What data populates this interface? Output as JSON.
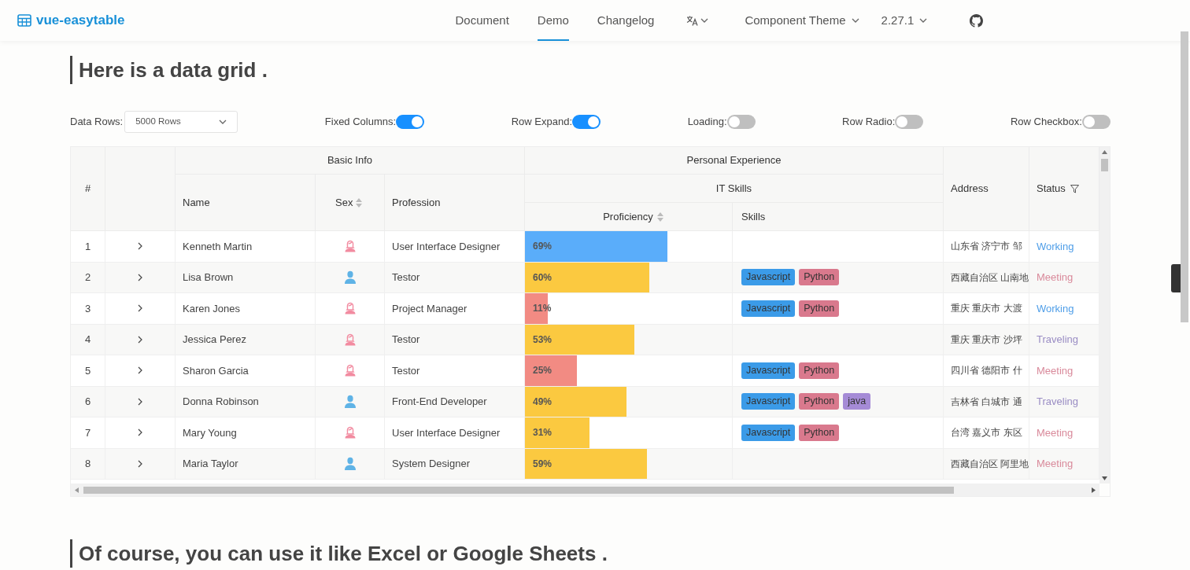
{
  "nav": {
    "logo": "vue-easytable",
    "links": [
      {
        "label": "Document",
        "selected": false
      },
      {
        "label": "Demo",
        "selected": true
      },
      {
        "label": "Changelog",
        "selected": false
      }
    ],
    "theme_menu": "Component Theme",
    "version_menu": "2.27.1"
  },
  "heading": "Here is a data grid .",
  "controls": {
    "data_rows_label": "Data Rows:",
    "data_rows_value": "5000 Rows",
    "toggles": [
      {
        "label": "Fixed Columns:",
        "on": true
      },
      {
        "label": "Row Expand:",
        "on": true
      },
      {
        "label": "Loading:",
        "on": false
      },
      {
        "label": "Row Radio:",
        "on": false
      },
      {
        "label": "Row Checkbox:",
        "on": false
      }
    ]
  },
  "table": {
    "header": {
      "index": "#",
      "basic_info": "Basic Info",
      "name": "Name",
      "sex": "Sex",
      "profession": "Profession",
      "personal_experience": "Personal Experience",
      "it_skills": "IT Skills",
      "proficiency": "Proficiency",
      "skills": "Skills",
      "address": "Address",
      "status": "Status"
    },
    "rows": [
      {
        "index": "1",
        "name": "Kenneth Martin",
        "kind": "female",
        "profession": "User Interface Designer",
        "proficiency": {
          "reading": "69%",
          "level": 0.69,
          "color": "#5aadfa"
        },
        "skills": [],
        "address": "山东省 济宁市 邹",
        "status": {
          "label": "Working",
          "color": "#4f9ee8"
        }
      },
      {
        "index": "2",
        "name": "Lisa Brown",
        "kind": "male",
        "profession": "Testor",
        "proficiency": {
          "reading": "60%",
          "level": 0.6,
          "color": "#fbc940"
        },
        "skills": [
          {
            "label": "Javascript",
            "color": "#3b9be8"
          },
          {
            "label": "Python",
            "color": "#d9798d"
          }
        ],
        "address": "西藏自治区 山南地",
        "status": {
          "label": "Meeting",
          "color": "#d98a9b"
        }
      },
      {
        "index": "3",
        "name": "Karen Jones",
        "kind": "female",
        "profession": "Project Manager",
        "proficiency": {
          "reading": "11%",
          "level": 0.11,
          "color": "#f28b83"
        },
        "skills": [
          {
            "label": "Javascript",
            "color": "#3b9be8"
          },
          {
            "label": "Python",
            "color": "#d9798d"
          }
        ],
        "address": "重庆 重庆市 大渡",
        "status": {
          "label": "Working",
          "color": "#4f9ee8"
        }
      },
      {
        "index": "4",
        "name": "Jessica Perez",
        "kind": "female",
        "profession": "Testor",
        "proficiency": {
          "reading": "53%",
          "level": 0.53,
          "color": "#fbc940"
        },
        "skills": [],
        "address": "重庆 重庆市 沙坪",
        "status": {
          "label": "Traveling",
          "color": "#9a8dc4"
        }
      },
      {
        "index": "5",
        "name": "Sharon Garcia",
        "kind": "female",
        "profession": "Testor",
        "proficiency": {
          "reading": "25%",
          "level": 0.25,
          "color": "#f28b83"
        },
        "skills": [
          {
            "label": "Javascript",
            "color": "#3b9be8"
          },
          {
            "label": "Python",
            "color": "#d9798d"
          }
        ],
        "address": "四川省 德阳市 什",
        "status": {
          "label": "Meeting",
          "color": "#d98a9b"
        }
      },
      {
        "index": "6",
        "name": "Donna Robinson",
        "kind": "male",
        "profession": "Front-End Developer",
        "proficiency": {
          "reading": "49%",
          "level": 0.49,
          "color": "#fbc940"
        },
        "skills": [
          {
            "label": "Javascript",
            "color": "#3b9be8"
          },
          {
            "label": "Python",
            "color": "#d9798d"
          },
          {
            "label": "java",
            "color": "#a58bd6"
          }
        ],
        "address": "吉林省 白城市 通",
        "status": {
          "label": "Traveling",
          "color": "#9a8dc4"
        }
      },
      {
        "index": "7",
        "name": "Mary Young",
        "kind": "female",
        "profession": "User Interface Designer",
        "proficiency": {
          "reading": "31%",
          "level": 0.31,
          "color": "#fbc940"
        },
        "skills": [
          {
            "label": "Javascript",
            "color": "#3b9be8"
          },
          {
            "label": "Python",
            "color": "#d9798d"
          }
        ],
        "address": "台湾 嘉义市 东区",
        "status": {
          "label": "Meeting",
          "color": "#d98a9b"
        }
      },
      {
        "index": "8",
        "name": "Maria Taylor",
        "kind": "male",
        "profession": "System Designer",
        "proficiency": {
          "reading": "59%",
          "level": 0.59,
          "color": "#fbc940"
        },
        "skills": [],
        "address": "西藏自治区 阿里地",
        "status": {
          "label": "Meeting",
          "color": "#d98a9b"
        }
      }
    ]
  },
  "next_heading": "Of course, you can use it like Excel or Google Sheets ."
}
